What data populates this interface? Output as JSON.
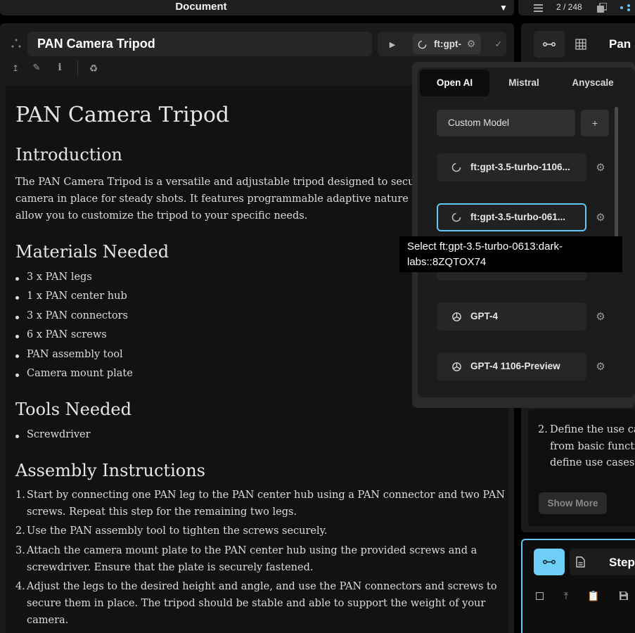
{
  "header": {
    "title": "Document",
    "page_counter": "2 / 248"
  },
  "document": {
    "title": "PAN Camera Tripod",
    "run_model_short": "ft:gpt-",
    "heading": "PAN Camera Tripod",
    "intro_heading": "Introduction",
    "intro_lines": [
      "The PAN Camera Tripod is a versatile and adjustable tripod designed to secure",
      "camera in place for steady shots. It features programmable adaptive nature co",
      "allow you to customize the tripod to your specific needs."
    ],
    "materials_heading": "Materials Needed",
    "materials": [
      "3 x PAN legs",
      "1 x PAN center hub",
      "3 x PAN connectors",
      "6 x PAN screws",
      "PAN assembly tool",
      "Camera mount plate"
    ],
    "tools_heading": "Tools Needed",
    "tools": [
      "Screwdriver"
    ],
    "assembly_heading": "Assembly Instructions",
    "steps": [
      {
        "n": "1.",
        "lines": [
          "Start by connecting one PAN leg to the PAN center hub using a PAN connector and two PAN",
          "screws. Repeat this step for the remaining two legs."
        ]
      },
      {
        "n": "2.",
        "lines": [
          "Use the PAN assembly tool to tighten the screws securely."
        ]
      },
      {
        "n": "3.",
        "lines": [
          "Attach the camera mount plate to the PAN center hub using the provided screws and a",
          "screwdriver. Ensure that the plate is securely fastened."
        ]
      },
      {
        "n": "4.",
        "lines": [
          "Adjust the legs to the desired height and angle, and use the PAN connectors and screws to",
          "secure them in place. The tripod should be stable and able to support the weight of your",
          "camera."
        ]
      }
    ]
  },
  "right_panel": {
    "title": "Pan I",
    "step_n": "2.",
    "step_lines": [
      "Define the use ca",
      "from basic functi",
      "define use cases"
    ],
    "show_more": "Show More",
    "card_title": "Step"
  },
  "model_menu": {
    "tabs": [
      "Open AI",
      "Mistral",
      "Anyscale"
    ],
    "active_tab": "Open AI",
    "custom_model": "Custom Model",
    "add": "+",
    "models": [
      "ft:gpt-3.5-turbo-1106...",
      "ft:gpt-3.5-turbo-061...",
      "GPT-4",
      "GPT-4 1106-Preview"
    ],
    "tooltip": [
      "Select ft:gpt-3.5-turbo-0613:dark-",
      "labs::8ZQTOX74"
    ]
  },
  "colors": {
    "accent": "#5fc8f4",
    "panel": "#1a1a1a",
    "background": "#000000"
  }
}
